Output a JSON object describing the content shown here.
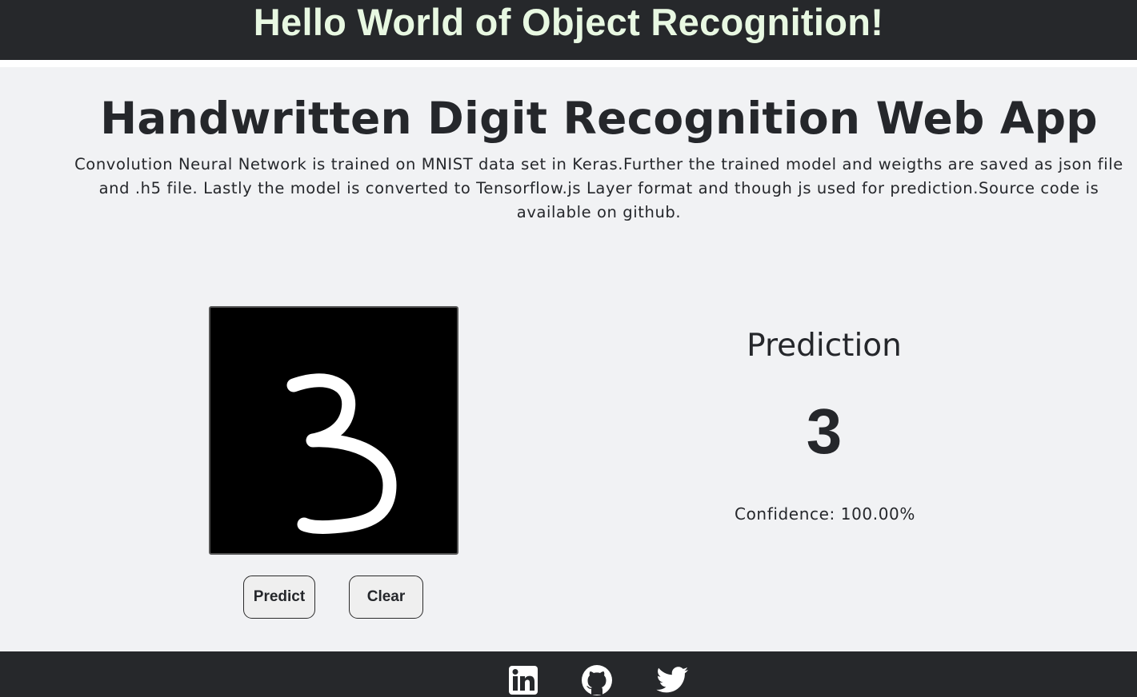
{
  "header": {
    "title": "Hello World of Object Recognition!"
  },
  "main": {
    "title": "Handwritten Digit Recognition Web App",
    "description": "Convolution Neural Network is trained on MNIST data set in Keras.Further the trained model and weigths are saved as json file and .h5 file. Lastly the model is converted to Tensorflow.js Layer format and though js used for prediction.Source code is available on github."
  },
  "canvas": {
    "drawn_digit": "3",
    "background_color": "#000000",
    "stroke_color": "#ffffff"
  },
  "buttons": {
    "predict_label": "Predict",
    "clear_label": "Clear"
  },
  "prediction": {
    "title": "Prediction",
    "digit": "3",
    "confidence_text": "Confidence: 100.00%"
  },
  "footer": {
    "icons": [
      "linkedin-icon",
      "github-icon",
      "twitter-icon"
    ]
  },
  "colors": {
    "header_bg": "#26282b",
    "header_text": "#e8f8e2",
    "page_bg": "#f1f2f4",
    "text": "#25272b"
  }
}
